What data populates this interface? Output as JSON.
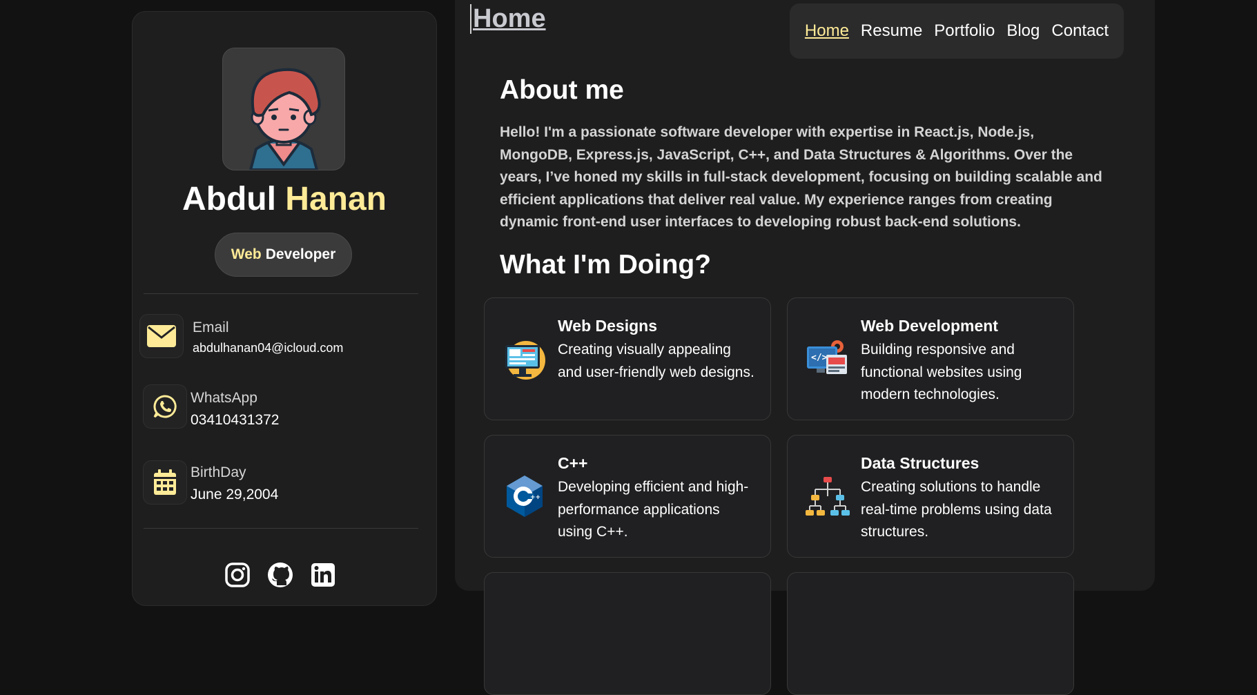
{
  "sidebar": {
    "name_first": "Abdul",
    "name_last": "Hanan",
    "role_1": "Web",
    "role_2": "Developer",
    "contacts": [
      {
        "label": "Email",
        "value": "abdulhanan04@icloud.com",
        "icon": "mail-icon"
      },
      {
        "label": "WhatsApp",
        "value": "03410431372",
        "icon": "whatsapp-icon"
      },
      {
        "label": "BirthDay",
        "value": "June 29,2004",
        "icon": "calendar-icon"
      }
    ],
    "socials": [
      "instagram-icon",
      "github-icon",
      "linkedin-icon"
    ]
  },
  "main": {
    "page_title": "Home",
    "nav": [
      "Home",
      "Resume",
      "Portfolio",
      "Blog",
      "Contact"
    ],
    "about_heading": "About me",
    "about_text": "Hello! I'm a passionate software developer with expertise in React.js, Node.js, MongoDB, Express.js, JavaScript, C++, and Data Structures & Algorithms. Over the years, I’ve honed my skills in full-stack development, focusing on building scalable and efficient applications that deliver real value. My experience ranges from creating dynamic front-end user interfaces to developing robust back-end solutions.",
    "doing_heading": "What I'm Doing?",
    "services": [
      {
        "title": "Web Designs",
        "text": "Creating visually appealing and user-friendly web designs.",
        "icon": "web-design-icon"
      },
      {
        "title": "Web Development",
        "text": "Building responsive and functional websites using modern technologies.",
        "icon": "web-development-icon"
      },
      {
        "title": "C++",
        "text": "Developing efficient and high-performance applications using C++.",
        "icon": "cpp-icon"
      },
      {
        "title": "Data Structures",
        "text": "Creating solutions to handle real-time problems using data structures.",
        "icon": "data-structures-icon"
      }
    ]
  },
  "colors": {
    "accent": "#ffeb97",
    "page_bg": "#121212",
    "panel_bg": "#1e1e1f"
  }
}
